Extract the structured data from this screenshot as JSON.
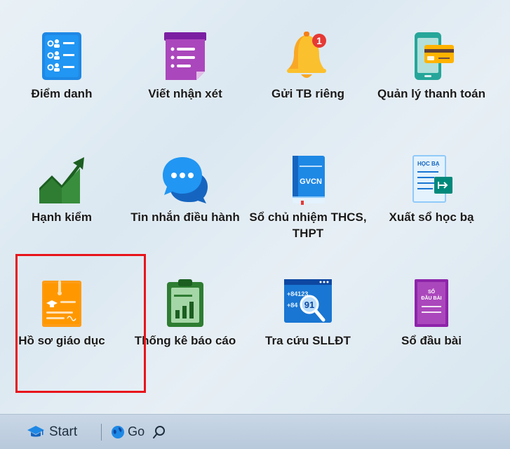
{
  "tiles": [
    {
      "label": "Điểm danh",
      "icon": "attendance-list-icon"
    },
    {
      "label": "Viết nhận xét",
      "icon": "comment-note-icon"
    },
    {
      "label": "Gửi TB riêng",
      "icon": "notification-bell-icon",
      "badge": "1"
    },
    {
      "label": "Quản lý thanh toán",
      "icon": "payment-phone-card-icon"
    },
    {
      "label": "Hạnh kiểm",
      "icon": "growth-chart-icon"
    },
    {
      "label": "Tin nhắn điều hành",
      "icon": "chat-bubbles-icon"
    },
    {
      "label": "Sổ chủ nhiệm THCS, THPT",
      "icon": "gvcn-book-icon",
      "book_text": "GVCN"
    },
    {
      "label": "Xuất sổ học bạ",
      "icon": "hoc-ba-export-icon",
      "doc_text": "HỌC BẠ"
    },
    {
      "label": "Hồ sơ giáo dục",
      "icon": "education-folder-icon"
    },
    {
      "label": "Thống kê báo cáo",
      "icon": "clipboard-chart-icon"
    },
    {
      "label": "Tra cứu SLLĐT",
      "icon": "phone-lookup-icon",
      "number_text": "+84123",
      "number_text2": "+84",
      "zoom_text": "91"
    },
    {
      "label": "Sổ đầu bài",
      "icon": "so-dau-bai-book-icon",
      "book_text_top": "SỔ",
      "book_text_bottom": "ĐẦU BÀI"
    }
  ],
  "taskbar": {
    "start_label": "Start",
    "go_label": "Go"
  },
  "colors": {
    "highlight": "#e8141b",
    "taskbar": "#c2d2e3"
  }
}
